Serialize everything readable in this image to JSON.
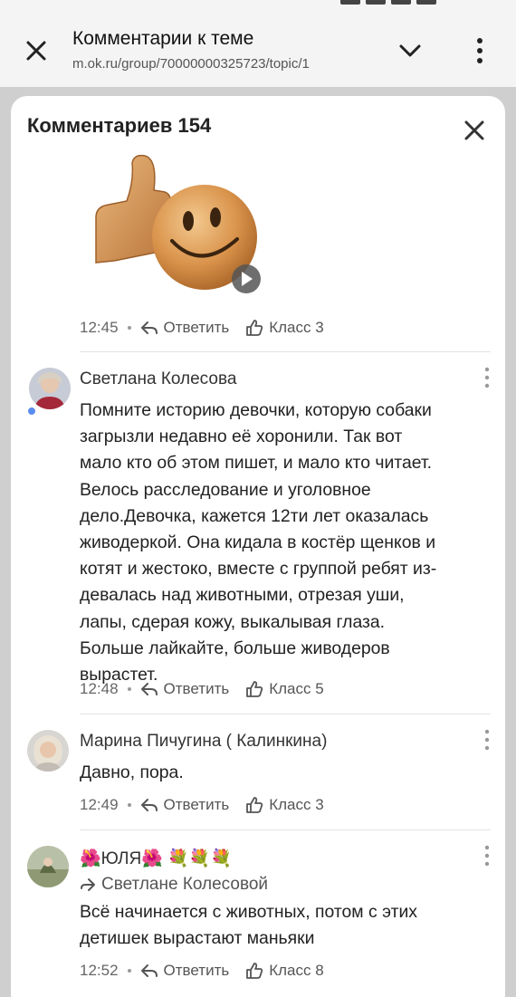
{
  "browser": {
    "title": "Комментарии к теме",
    "url": "m.ok.ru/group/70000000325723/topic/1"
  },
  "sheet": {
    "title": "Комментариев 154"
  },
  "first": {
    "time": "12:45",
    "reply_label": "Ответить",
    "like_label": "Класс 3"
  },
  "comments": [
    {
      "author": "Светлана Колесова",
      "text_lines": [
        "Помните историю девочки, которую собаки",
        "загрызли недавно её хоронили. Так вот",
        "мало кто об этом пишет, и мало кто читает.",
        "Велось расследование и уголовное",
        "дело.Девочка, кажется 12ти лет оказалась",
        "живодеркой. Она кидала в костёр щенков и",
        "котят и жестоко, вместе с группой ребят из-",
        "девалась над животными, отрезая уши,",
        "лапы, сдерая кожу, выкалывая глаза.",
        "Больше лайкайте, больше живодеров",
        "вырастет."
      ],
      "time": "12:48",
      "reply_label": "Ответить",
      "like_label": "Класс 5"
    },
    {
      "author": "Марина Пичугина ( Калинкина)",
      "text_lines": [
        "Давно, пора."
      ],
      "time": "12:49",
      "reply_label": "Ответить",
      "like_label": "Класс 3"
    },
    {
      "author": "🌺ЮЛЯ🌺 💐💐💐",
      "reply_to": "Светлане Колесовой",
      "text_lines": [
        "Всё начинается с животных, потом с этих",
        "детишек вырастают маньяки"
      ],
      "time": "12:52",
      "reply_label": "Ответить",
      "like_label": "Класс 8"
    }
  ],
  "colors": {
    "online": "#5b8def",
    "sheet_bg": "#ffffff",
    "backdrop": "#cfcfcf"
  }
}
